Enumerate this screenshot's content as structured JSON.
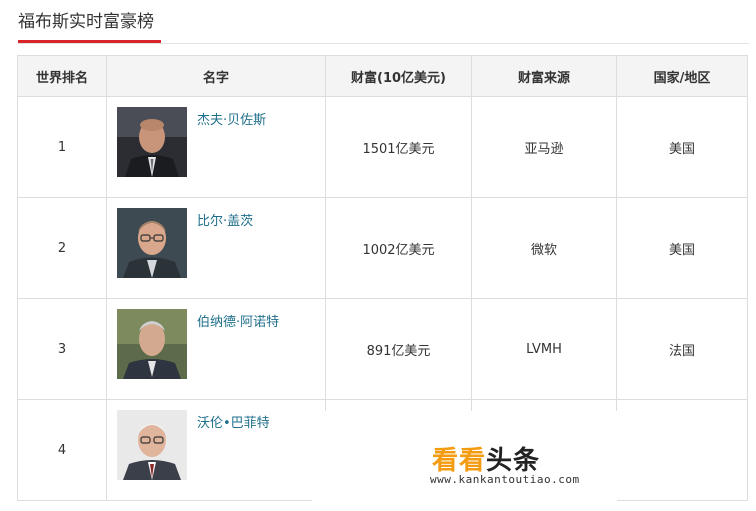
{
  "page_title": "福布斯实时富豪榜",
  "table": {
    "headers": [
      "世界排名",
      "名字",
      "财富(10亿美元)",
      "财富来源",
      "国家/地区"
    ],
    "rows": [
      {
        "rank": "1",
        "name": "杰夫·贝佐斯",
        "wealth": "1501亿美元",
        "source": "亚马逊",
        "country": "美国"
      },
      {
        "rank": "2",
        "name": "比尔·盖茨",
        "wealth": "1002亿美元",
        "source": "微软",
        "country": "美国"
      },
      {
        "rank": "3",
        "name": "伯纳德·阿诺特",
        "wealth": "891亿美元",
        "source": "LVMH",
        "country": "法国"
      },
      {
        "rank": "4",
        "name": "沃伦•巴菲特",
        "wealth": "",
        "source": "",
        "country": ""
      }
    ]
  },
  "watermark": {
    "brand_kan": "看看",
    "brand_toutiao": "头条",
    "url": "www.kankantoutiao.com"
  },
  "colors": {
    "accent": "#d8232a",
    "link": "#1f6f8b",
    "header_bg": "#f4f4f4",
    "border": "#dddddd"
  }
}
